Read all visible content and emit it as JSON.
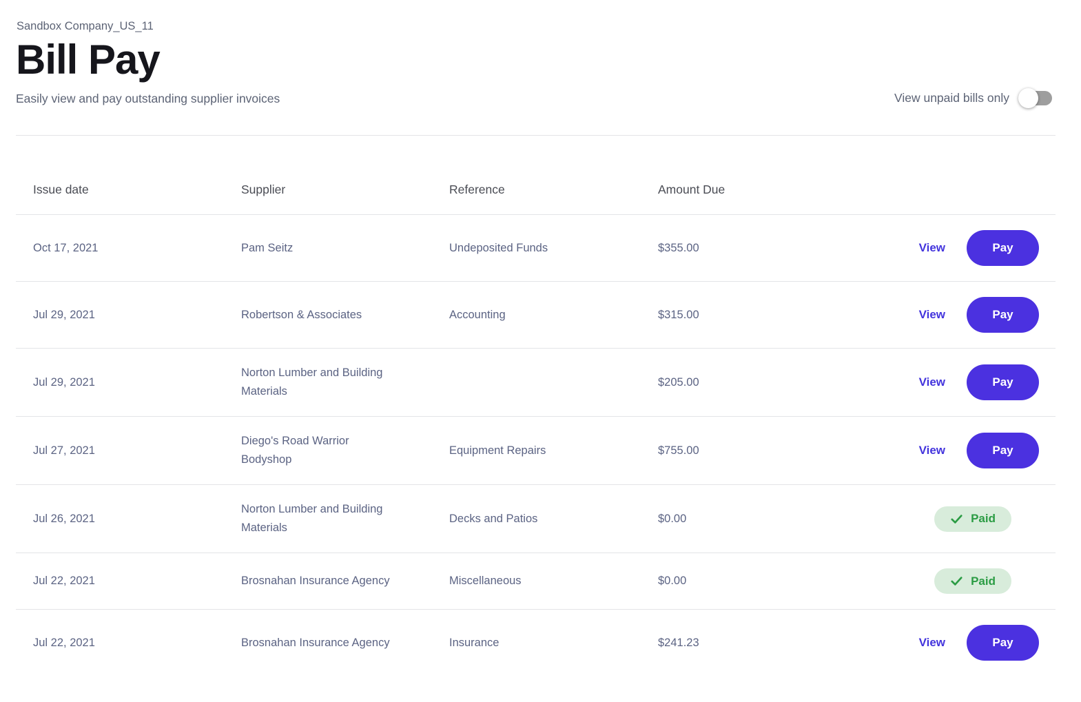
{
  "header": {
    "company": "Sandbox Company_US_11",
    "title": "Bill Pay",
    "subtitle": "Easily view and pay outstanding supplier invoices",
    "toggle_label": "View unpaid bills only",
    "toggle_on": false
  },
  "table": {
    "columns": [
      "Issue date",
      "Supplier",
      "Reference",
      "Amount Due"
    ],
    "actions": {
      "view_label": "View",
      "pay_label": "Pay",
      "paid_label": "Paid"
    },
    "rows": [
      {
        "issue_date": "Oct 17, 2021",
        "supplier": "Pam Seitz",
        "reference": "Undeposited Funds",
        "amount_due": "$355.00",
        "status": "unpaid"
      },
      {
        "issue_date": "Jul 29, 2021",
        "supplier": "Robertson & Associates",
        "reference": "Accounting",
        "amount_due": "$315.00",
        "status": "unpaid"
      },
      {
        "issue_date": "Jul 29, 2021",
        "supplier": "Norton Lumber and Building Materials",
        "reference": "",
        "amount_due": "$205.00",
        "status": "unpaid"
      },
      {
        "issue_date": "Jul 27, 2021",
        "supplier": "Diego's Road Warrior Bodyshop",
        "reference": "Equipment Repairs",
        "amount_due": "$755.00",
        "status": "unpaid"
      },
      {
        "issue_date": "Jul 26, 2021",
        "supplier": "Norton Lumber and Building Materials",
        "reference": "Decks and Patios",
        "amount_due": "$0.00",
        "status": "paid"
      },
      {
        "issue_date": "Jul 22, 2021",
        "supplier": "Brosnahan Insurance Agency",
        "reference": "Miscellaneous",
        "amount_due": "$0.00",
        "status": "paid"
      },
      {
        "issue_date": "Jul 22, 2021",
        "supplier": "Brosnahan Insurance Agency",
        "reference": "Insurance",
        "amount_due": "$241.23",
        "status": "unpaid"
      }
    ]
  },
  "colors": {
    "accent": "#4b31e0",
    "view_link": "#4334dd",
    "paid_bg": "#d8ecdb",
    "paid_text": "#2b9c44",
    "divider": "#e3e4e7",
    "cell_text": "#5b6383",
    "header_text": "#4a4c54",
    "muted_text": "#5c6375",
    "title_text": "#16161c",
    "toggle_track": "#9e9e9e"
  }
}
